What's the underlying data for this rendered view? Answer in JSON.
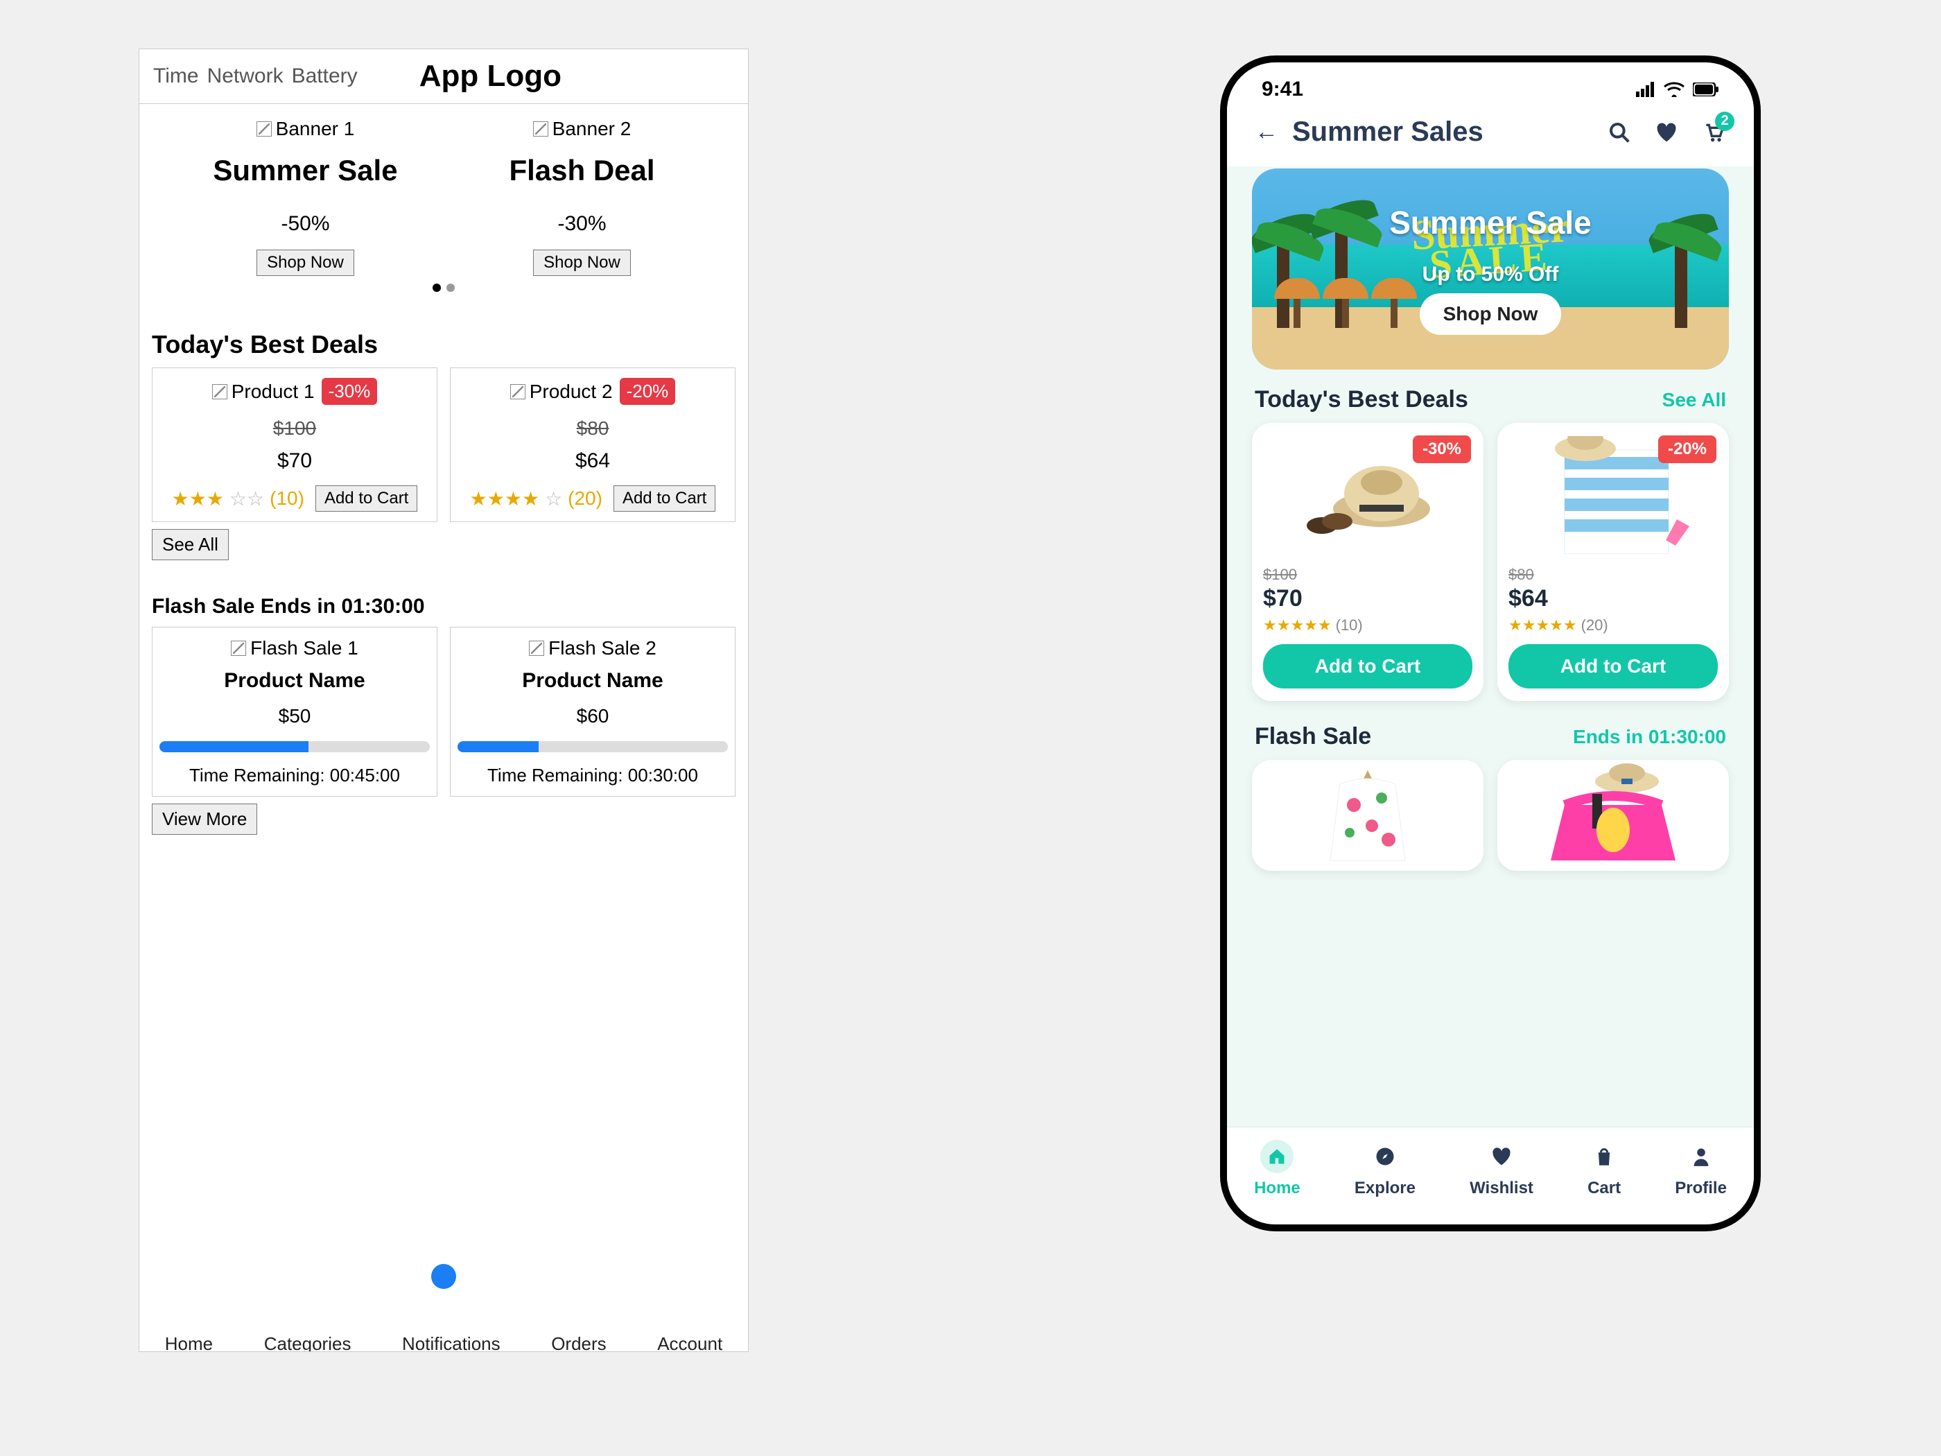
{
  "wireframe": {
    "status": {
      "time": "Time",
      "network": "Network",
      "battery": "Battery"
    },
    "logo": "App Logo",
    "banners": [
      {
        "img": "Banner 1",
        "title": "Summer Sale",
        "discount": "-50%",
        "cta": "Shop Now"
      },
      {
        "img": "Banner 2",
        "title": "Flash Deal",
        "discount": "-30%",
        "cta": "Shop Now"
      }
    ],
    "deals_title": "Today's Best Deals",
    "deals": [
      {
        "img": "Product 1",
        "badge": "-30%",
        "old": "$100",
        "new": "$70",
        "stars": 3,
        "reviews": "(10)",
        "cta": "Add to Cart"
      },
      {
        "img": "Product 2",
        "badge": "-20%",
        "old": "$80",
        "new": "$64",
        "stars": 4,
        "reviews": "(20)",
        "cta": "Add to Cart"
      }
    ],
    "see_all": "See All",
    "flash_title": "Flash Sale Ends in 01:30:00",
    "flash": [
      {
        "img": "Flash Sale 1",
        "name": "Product Name",
        "price": "$50",
        "progress": 55,
        "remain": "Time Remaining: 00:45:00"
      },
      {
        "img": "Flash Sale 2",
        "name": "Product Name",
        "price": "$60",
        "progress": 30,
        "remain": "Time Remaining: 00:30:00"
      }
    ],
    "view_more": "View More",
    "nav": [
      "Home",
      "Categories",
      "Notifications",
      "Orders",
      "Account"
    ]
  },
  "mockup": {
    "status_time": "9:41",
    "header_title": "Summer Sales",
    "cart_count": "2",
    "banner": {
      "title": "Summer Sale",
      "script1": "Summer",
      "script2": "SALE",
      "subtitle": "Up to 50% Off",
      "cta": "Shop Now"
    },
    "deals_title": "Today's Best Deals",
    "see_all": "See All",
    "deals": [
      {
        "badge": "-30%",
        "old": "$100",
        "price": "$70",
        "reviews": "(10)",
        "cta": "Add to Cart"
      },
      {
        "badge": "-20%",
        "old": "$80",
        "price": "$64",
        "reviews": "(20)",
        "cta": "Add to Cart"
      }
    ],
    "flash_title": "Flash Sale",
    "flash_ends": "Ends in 01:30:00",
    "nav": [
      {
        "label": "Home"
      },
      {
        "label": "Explore"
      },
      {
        "label": "Wishlist"
      },
      {
        "label": "Cart"
      },
      {
        "label": "Profile"
      }
    ]
  },
  "colors": {
    "accent": "#12c7a8",
    "danger": "#f04a4a",
    "navy": "#2b3a55"
  }
}
